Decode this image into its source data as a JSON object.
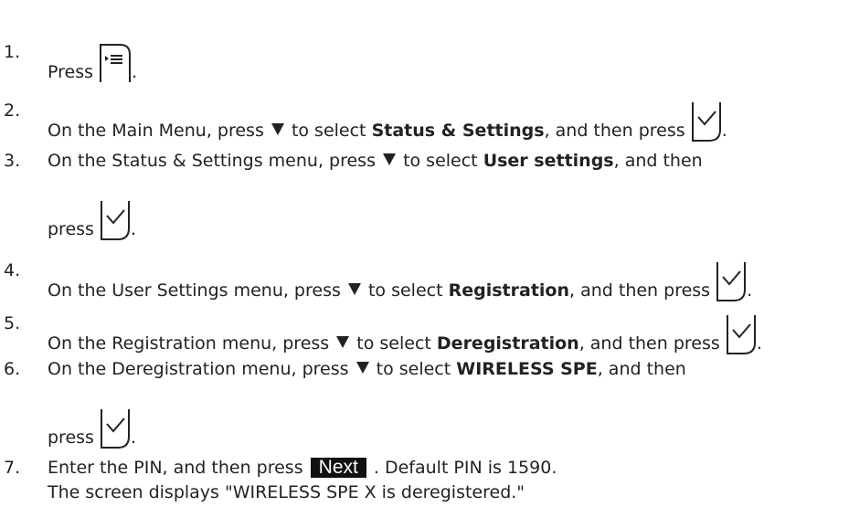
{
  "steps": [
    {
      "num": "1.",
      "pre": "Press",
      "icon": "menu-key-icon",
      "post": "."
    },
    {
      "num": "2.",
      "pre": "On the Main Menu, press",
      "mid": "to select",
      "bold": "Status & Settings",
      "post": ", and then press",
      "icon": "ok-key-icon",
      "end": "."
    },
    {
      "num": "3.",
      "pre": "On the Status & Settings menu, press",
      "mid": "to select",
      "bold": "User settings",
      "post": ", and then",
      "line2": "press",
      "icon": "ok-key-icon",
      "end": "."
    },
    {
      "num": "4.",
      "pre": "On the User Settings menu, press",
      "mid": "to select",
      "bold": "Registration",
      "post": ", and then press",
      "icon": "ok-key-icon",
      "end": "."
    },
    {
      "num": "5.",
      "pre": "On the Registration menu, press",
      "mid": "to select",
      "bold": "Deregistration",
      "post": ", and then press",
      "icon": "ok-key-icon",
      "end": "."
    },
    {
      "num": "6.",
      "pre": "On the Deregistration menu, press",
      "mid": "to select",
      "bold": "WIRELESS SPE",
      "post": ", and then",
      "line2": "press",
      "icon": "ok-key-icon",
      "end": "."
    },
    {
      "num": "7.",
      "pre": "Enter the PIN, and then press",
      "button": "Next",
      "post": ". Default PIN is 1590.",
      "line2": "The screen displays \"WIRELESS SPE X is deregistered.\""
    }
  ],
  "icon_color": "#222222"
}
